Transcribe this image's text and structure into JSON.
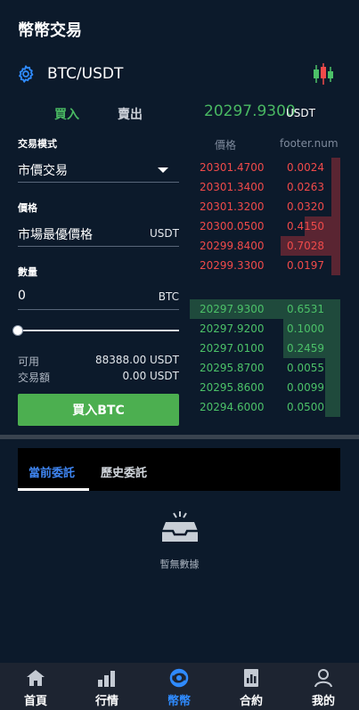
{
  "header": {
    "title": "幣幣交易"
  },
  "pair": {
    "name": "BTC/USDT"
  },
  "tabs": {
    "buy": "買入",
    "sell": "賣出"
  },
  "ticker": {
    "price": "20297.9300",
    "unit": "USDT"
  },
  "form": {
    "mode_label": "交易模式",
    "mode_value": "市價交易",
    "price_label": "價格",
    "price_value": "市場最優價格",
    "price_unit": "USDT",
    "qty_label": "數量",
    "qty_value": "0",
    "qty_unit": "BTC",
    "slider_percent": 0,
    "available_label": "可用",
    "available_value": "88388.00 USDT",
    "amount_label": "交易額",
    "amount_value": "0.00 USDT",
    "submit_label": "買入BTC"
  },
  "orderbook": {
    "price_header": "價格",
    "qty_header": "footer.num",
    "asks": [
      {
        "price": "20301.4700",
        "qty": "0.0024",
        "depth": 0.1
      },
      {
        "price": "20301.3400",
        "qty": "0.0263",
        "depth": 0.1
      },
      {
        "price": "20301.3200",
        "qty": "0.0320",
        "depth": 0.1
      },
      {
        "price": "20300.0500",
        "qty": "0.4150",
        "depth": 0.38
      },
      {
        "price": "20299.8400",
        "qty": "0.7028",
        "depth": 0.64
      },
      {
        "price": "20299.3300",
        "qty": "0.0197",
        "depth": 0.1
      }
    ],
    "bids": [
      {
        "price": "20297.9300",
        "qty": "0.6531",
        "depth": 1.0
      },
      {
        "price": "20297.9200",
        "qty": "0.1000",
        "depth": 0.38
      },
      {
        "price": "20297.0100",
        "qty": "0.2459",
        "depth": 0.38
      },
      {
        "price": "20295.8700",
        "qty": "0.0055",
        "depth": 0.1
      },
      {
        "price": "20295.8600",
        "qty": "0.0099",
        "depth": 0.1
      },
      {
        "price": "20294.6000",
        "qty": "0.0500",
        "depth": 0.1
      }
    ]
  },
  "orders": {
    "tab_current": "當前委託",
    "tab_history": "歷史委託",
    "empty_text": "暫無數據"
  },
  "nav": [
    {
      "label": "首頁",
      "icon": "home-icon"
    },
    {
      "label": "行情",
      "icon": "market-icon"
    },
    {
      "label": "幣幣",
      "icon": "exchange-icon"
    },
    {
      "label": "合約",
      "icon": "contract-icon"
    },
    {
      "label": "我的",
      "icon": "profile-icon"
    }
  ],
  "colors": {
    "buy": "#4cc168",
    "sell": "#f04a4a",
    "accent": "#2f8bff",
    "background": "#0c1a2b"
  }
}
